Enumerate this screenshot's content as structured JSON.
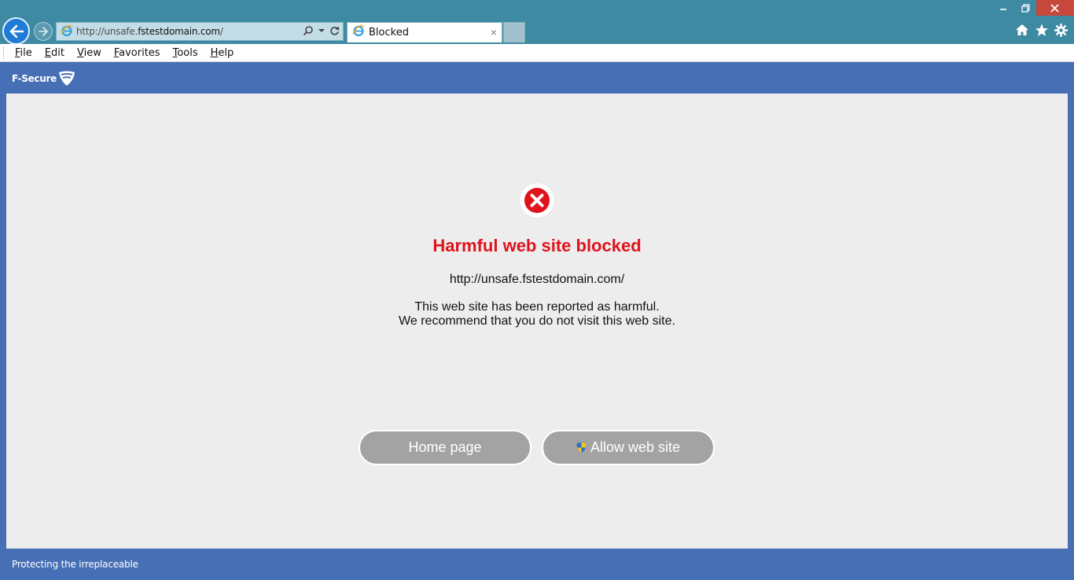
{
  "browser": {
    "address": {
      "url_prefix": "http://unsafe.",
      "url_host": "fstestdomain.com",
      "url_suffix": "/"
    },
    "tab": {
      "label": "Blocked",
      "close": "×"
    },
    "menu": {
      "items": [
        {
          "underline": "F",
          "rest": "ile"
        },
        {
          "underline": "E",
          "rest": "dit"
        },
        {
          "underline": "V",
          "rest": "iew"
        },
        {
          "underline": "F",
          "rest": "avorites"
        },
        {
          "underline": "T",
          "rest": "ools"
        },
        {
          "underline": "H",
          "rest": "elp"
        }
      ]
    }
  },
  "page": {
    "brand": "F-Secure",
    "headline": "Harmful web site blocked",
    "blocked_url": "http://unsafe.fstestdomain.com/",
    "message_line1": "This web site has been reported as harmful.",
    "message_line2": "We recommend that you do not visit this web site.",
    "home_button": "Home page",
    "allow_button": "Allow web site",
    "tagline": "Protecting the irreplaceable"
  },
  "colors": {
    "brand_blue": "#476fb5",
    "alert_red": "#e0121b",
    "button_gray": "#a3a3a3"
  }
}
